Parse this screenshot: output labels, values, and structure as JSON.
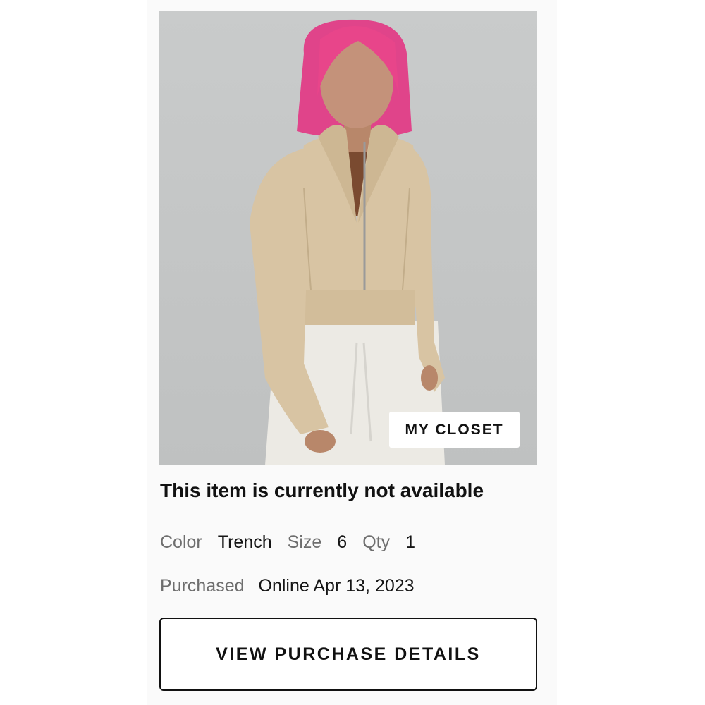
{
  "product": {
    "image_alt": "Model wearing cropped zip hoodie in Trench",
    "badge_label": "MY CLOSET",
    "status_text": "This item is currently not available",
    "attributes": {
      "color_label": "Color",
      "color_value": "Trench",
      "size_label": "Size",
      "size_value": "6",
      "qty_label": "Qty",
      "qty_value": "1"
    },
    "purchase": {
      "label": "Purchased",
      "value": "Online Apr 13, 2023"
    },
    "button_label": "VIEW PURCHASE DETAILS"
  },
  "colors": {
    "jacket": "#d8c4a3",
    "hair": "#e8458a",
    "pants": "#ecebe6",
    "background": "#c7c9c9"
  }
}
